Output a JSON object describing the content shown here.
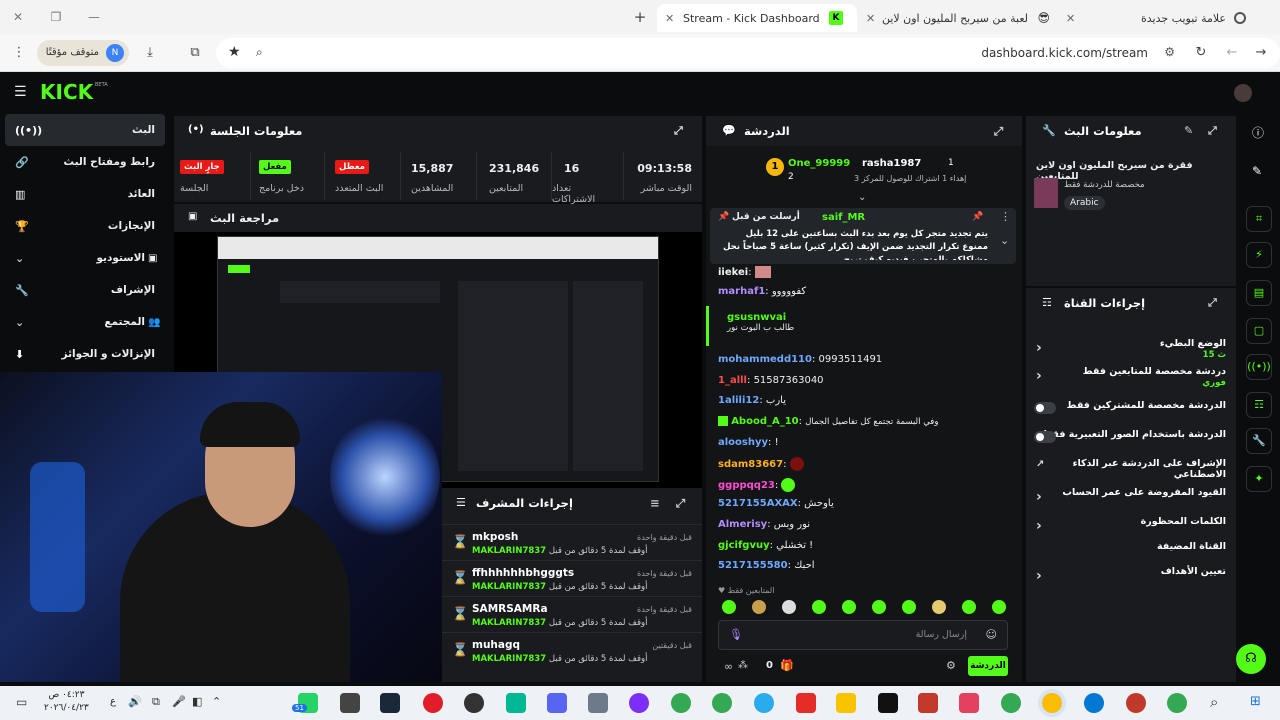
{
  "browser": {
    "tabs": [
      {
        "label": "Stream - Kick Dashboard",
        "active": true
      },
      {
        "label": "لعبة من سيربح المليون اون لاين",
        "active": false
      },
      {
        "label": "علامة تبويب جديدة",
        "active": false
      }
    ],
    "url": "dashboard.kick.com/stream",
    "paused_label": "متوقف مؤقتًا",
    "profile_initial": "N"
  },
  "kick": {
    "logo": "KICK",
    "logo_beta": "BETA",
    "nav": [
      {
        "label": "البث"
      },
      {
        "label": "رابط ومفتاح البث"
      },
      {
        "label": "العائد"
      },
      {
        "label": "الإنجازات"
      },
      {
        "label": "الاستوديو"
      },
      {
        "label": "الإشراف"
      },
      {
        "label": "المجتمع"
      },
      {
        "label": "الإنزالات و الجوائز"
      }
    ]
  },
  "session": {
    "title": "معلومات الجلسة",
    "items": [
      {
        "value": "09:13:58",
        "label": "الوقت مباشر"
      },
      {
        "value": "16",
        "label": "تعداد الاشتراكات"
      },
      {
        "value": "231,846",
        "label": "المتابعين"
      },
      {
        "value": "15,887",
        "label": "المشاهدين"
      },
      {
        "badge": "معطل",
        "label": "البث المتعدد"
      },
      {
        "badge": "مفعل",
        "label": "دخل برنامج"
      },
      {
        "badge": "جارٍ البث",
        "label": "الجلسة"
      }
    ]
  },
  "preview": {
    "title": "مراجعة البث"
  },
  "mod": {
    "title": "إجراءات المشرف",
    "rows": [
      {
        "user": "mkposh",
        "action": "أوقف لمدة 5 دقائق من قبل",
        "mod": "MAKLARIN7837",
        "time": "قبل دقيقة واحدة"
      },
      {
        "user": "ffhhhhhhbhgggts",
        "action": "أوقف لمدة 5 دقائق من قبل",
        "mod": "MAKLARIN7837",
        "time": "قبل دقيقة واحدة"
      },
      {
        "user": "SAMRSAMRa",
        "action": "أوقف لمدة 5 دقائق من قبل",
        "mod": "MAKLARIN7837",
        "time": "قبل دقيقة واحدة"
      },
      {
        "user": "muhagq",
        "action": "أوقف لمدة 5 دقائق من قبل",
        "mod": "MAKLARIN7837",
        "time": "قبل دقيقتين"
      }
    ]
  },
  "chat": {
    "title": "الدردشة",
    "top": {
      "rank1": "1",
      "rank2": "2",
      "user1": "rasha1987",
      "user2": "One_99999",
      "sub": "إهداء 1 اشتراك للوصول للمركز 3"
    },
    "pinned": {
      "by_label": "أرسلت من قبل",
      "user": "saif_MR",
      "text": "يتم تجديد متجر كل يوم بعد بدء البث بساعتين على 12 بليل ممنوع تكرار التجديد ضمن الإيف (تكرار كثير) ساعة 5 صباحاً نحل مشاكلكم بالمتجر ، فيديو كيف تربح"
    },
    "messages": [
      {
        "user": "iiekei",
        "text": "",
        "color": "#f2f2f2"
      },
      {
        "user": "marhaf1",
        "text": "كفووووو",
        "color": "#b38cff"
      },
      {
        "user": "gsusnwvai",
        "text": "طالب ب البوت نور",
        "color": "#53fc18"
      },
      {
        "user": "mohammedd110",
        "text": "0993511491",
        "color": "#6fa8ff"
      },
      {
        "user": "1_alll",
        "text": "51587363040",
        "color": "#ff4d4d"
      },
      {
        "user": "1alili12",
        "text": "يارب",
        "color": "#6fa8ff"
      },
      {
        "user": "Abood_A_10",
        "text": "وفي البسمة تجتمع كل تفاصيل الجمال",
        "color": "#53fc18"
      },
      {
        "user": "alooshyy",
        "text": "!",
        "color": "#6fa8ff"
      },
      {
        "user": "sdam83667",
        "text": "",
        "color": "#ffb020"
      },
      {
        "user": "ggppqq23",
        "text": "",
        "color": "#ff4dd2"
      },
      {
        "user": "5217155AXAX",
        "text": "ياوحش",
        "color": "#6fa8ff"
      },
      {
        "user": "Almerisy",
        "text": "نور وبس",
        "color": "#b38cff"
      },
      {
        "user": "gjcifgvuy",
        "text": "تخشلي !",
        "color": "#53fc18"
      },
      {
        "user": "5217155580",
        "text": "احبك",
        "color": "#6fa8ff"
      }
    ],
    "followers_only": "المتابعين فقط",
    "input_placeholder": "إرسال رسالة",
    "send_label": "الدردشة",
    "count": "0"
  },
  "streaminfo": {
    "title": "معلومات البث",
    "stream_title": "فقرة من سيربح المليون اون لاين للمتابعين",
    "subtitle": "مخصصة للدردشة فقط",
    "tag": "Arabic"
  },
  "channel": {
    "title": "إجراءات القناة",
    "rows": [
      {
        "label": "الوضع البطيء",
        "sub": "15 ث",
        "kind": "arrow"
      },
      {
        "label": "دردشة مخصصة للمتابعين فقط",
        "sub": "فوري",
        "kind": "arrow"
      },
      {
        "label": "الدردشة مخصصة للمشتركين فقط",
        "sub": "",
        "kind": "toggle"
      },
      {
        "label": "الدردشة باستخدام الصور التعبيرية فقط",
        "sub": "",
        "kind": "toggle"
      },
      {
        "label": "الإشراف على الدردشة عبر الذكاء الاصطناعي",
        "sub": "",
        "kind": "ext"
      },
      {
        "label": "القيود المفروضة على عمر الحساب",
        "sub": "",
        "kind": "arrow"
      },
      {
        "label": "الكلمات المحظورة",
        "sub": "",
        "kind": "arrow"
      },
      {
        "label": "القناة المضيفة",
        "sub": "",
        "kind": "none"
      },
      {
        "label": "تعيين الأهداف",
        "sub": "",
        "kind": "arrow"
      }
    ]
  },
  "taskbar": {
    "time": "٠٤:٢٣ ص",
    "date": "٢٠٢٦/٠٤/٢٣",
    "lang": "ع",
    "badge": "51"
  },
  "colors": {
    "accent": "#53fc18",
    "panel": "#191b1f",
    "bg": "#0b0c0d"
  }
}
